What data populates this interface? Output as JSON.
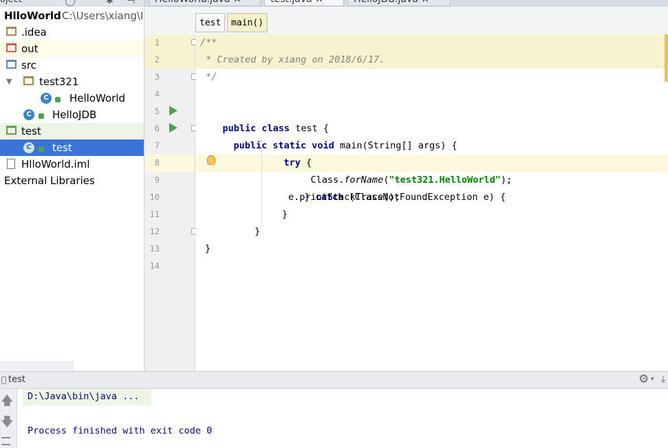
{
  "tabs": [
    {
      "label": "HelloWorld.java ×",
      "active": false
    },
    {
      "label": "test.java ×",
      "active": true
    },
    {
      "label": "HelloJDB.java ×",
      "active": false
    }
  ],
  "project": {
    "header_label": "oject",
    "root_name": "HlloWorld",
    "root_path": "C:\\Users\\xiang\\Io",
    "tree": [
      {
        "label": ".idea"
      },
      {
        "label": "out"
      },
      {
        "label": "src"
      },
      {
        "label": "test321"
      },
      {
        "label": "HelloWorld"
      },
      {
        "label": "HelloJDB"
      },
      {
        "label": "test"
      },
      {
        "label": "test"
      },
      {
        "label": "HlloWorld.iml"
      },
      {
        "label": "External Libraries"
      }
    ]
  },
  "breadcrumb": {
    "items": [
      "test",
      "main()"
    ]
  },
  "editor": {
    "line_numbers": [
      "1",
      "2",
      "3",
      "4",
      "5",
      "6",
      "7",
      "8",
      "9",
      "10",
      "11",
      "12",
      "13",
      "14"
    ],
    "code": {
      "l1": "/**",
      "l2": " * Created by xiang on 2018/6/17.",
      "l3": " */",
      "l5_kw": "public class",
      "l5_rest": " test {",
      "l6_kw": "public static void",
      "l6_rest": " main(String[] args) {",
      "l7_kw": "try",
      "l7_rest": " {",
      "l8_a": "Class.",
      "l8_b": "forName",
      "l8_c": "(",
      "l8_str": "\"test321.HelloWorld\"",
      "l8_d": ");",
      "l9_a": "} ",
      "l9_kw": "catch",
      "l9_rest": " (ClassNotFoundException e) {",
      "l10": "e.printStackTrace();",
      "l11": "}",
      "l12": "}",
      "l13": "}"
    }
  },
  "run": {
    "tab_label": "test",
    "console_line1": "D:\\Java\\bin\\java ...",
    "console_line2": "Process finished with exit code 0"
  },
  "icons": {
    "run": "run-arrow-icon",
    "settings": "gear-icon",
    "bulb": "lightbulb-icon"
  }
}
